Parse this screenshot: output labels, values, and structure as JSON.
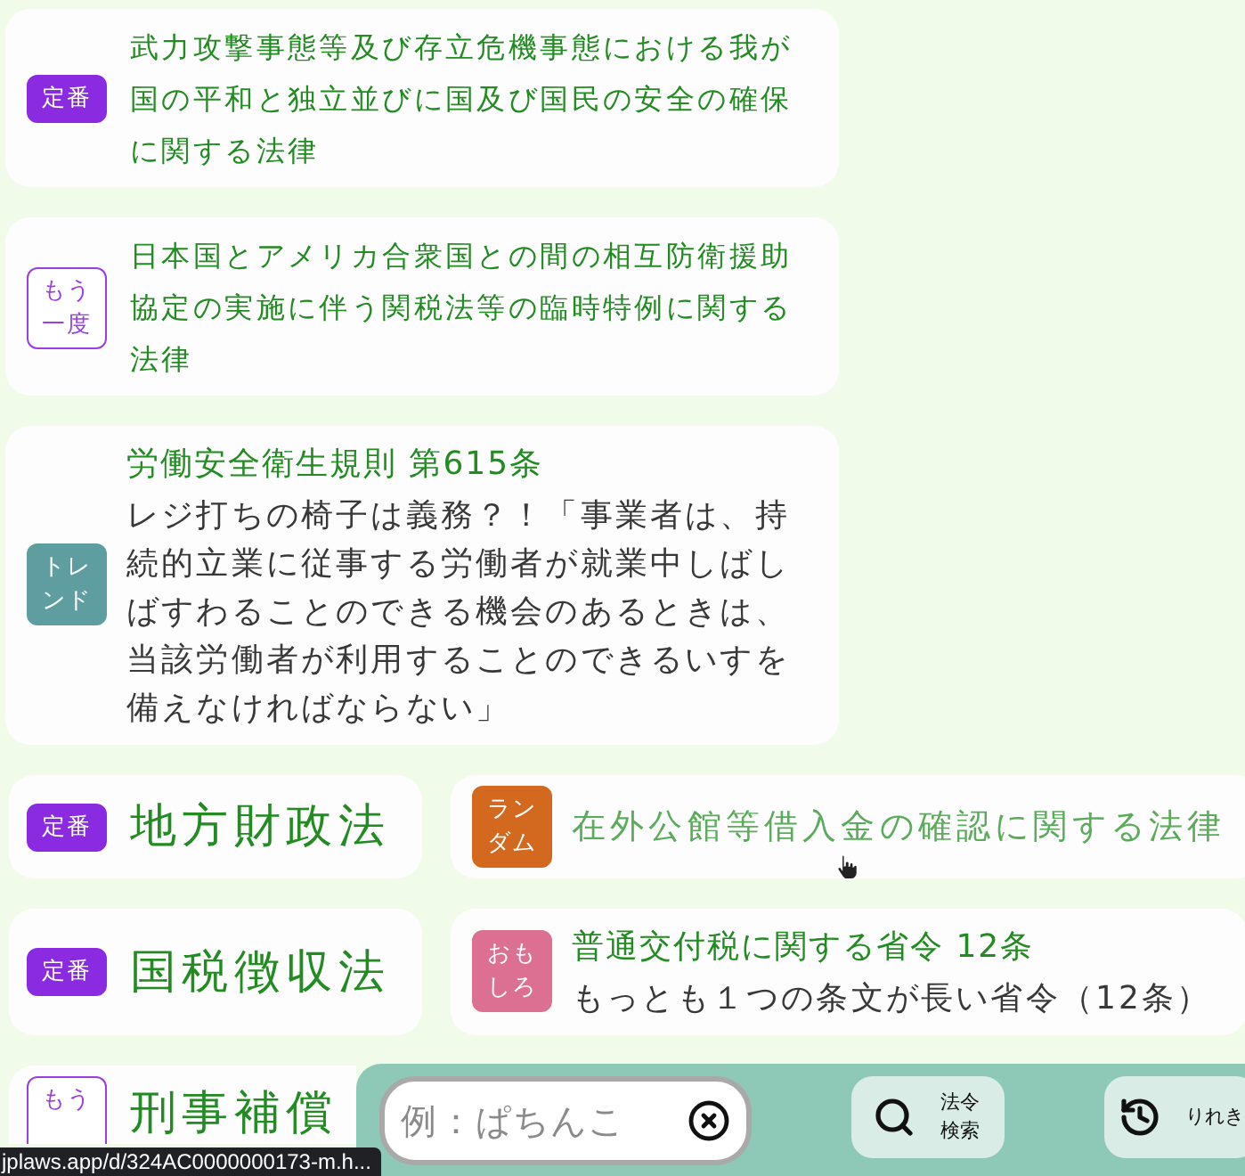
{
  "rows": [
    [
      {
        "kind": "law",
        "hovered": false,
        "badge": {
          "label": "定番",
          "color": "#8a2be2",
          "outlined": false
        },
        "title": "武力攻撃事態等及び存立危機事態における我が国の平和と独立並びに国及び国民の安全の確保に関する法律"
      }
    ],
    [
      {
        "kind": "law",
        "hovered": false,
        "badge": {
          "label": "もう一度",
          "color": "#9b3fe0",
          "outlined": true
        },
        "title": "日本国とアメリカ合衆国との間の相互防衛援助協定の実施に伴う関税法等の臨時特例に関する法律"
      }
    ],
    [
      {
        "kind": "article",
        "hovered": false,
        "badge": {
          "label": "トレンド",
          "color": "#5f9ea0",
          "outlined": false
        },
        "title": "労働安全衛生規則 第615条",
        "body": "レジ打ちの椅子は義務？！「事業者は、持続的立業に従事する労働者が就業中しばしばすわることのできる機会のあるときは、当該労働者が利用することのできるいすを備えなければならない」"
      }
    ],
    [
      {
        "kind": "short",
        "hovered": false,
        "badge": {
          "label": "定番",
          "color": "#8a2be2",
          "outlined": false
        },
        "title": "地方財政法"
      },
      {
        "kind": "headline",
        "hovered": true,
        "badge": {
          "label": "ランダム",
          "color": "#d2691e",
          "outlined": false
        },
        "title": "在外公館等借入金の確認に関する法律"
      }
    ],
    [
      {
        "kind": "short",
        "hovered": false,
        "badge": {
          "label": "定番",
          "color": "#8a2be2",
          "outlined": false
        },
        "title": "国税徴収法"
      },
      {
        "kind": "article",
        "hovered": false,
        "badge": {
          "label": "おもしろ",
          "color": "#db7093",
          "outlined": false
        },
        "title": "普通交付税に関する省令 12条",
        "body": "もっとも１つの条文が長い省令（12条）"
      }
    ],
    [
      {
        "kind": "clipped",
        "hovered": false,
        "badge": {
          "label": "もう",
          "color": "#9b3fe0",
          "outlined": true
        },
        "title": "刑事補償"
      }
    ]
  ],
  "search_bar": {
    "placeholder": "例：ぱちんこ"
  },
  "actions": [
    {
      "kind": "search",
      "label": "法令検索"
    },
    {
      "kind": "history",
      "label": "りれき"
    }
  ],
  "status_url": "jplaws.app/d/324AC0000000173-m.h..."
}
